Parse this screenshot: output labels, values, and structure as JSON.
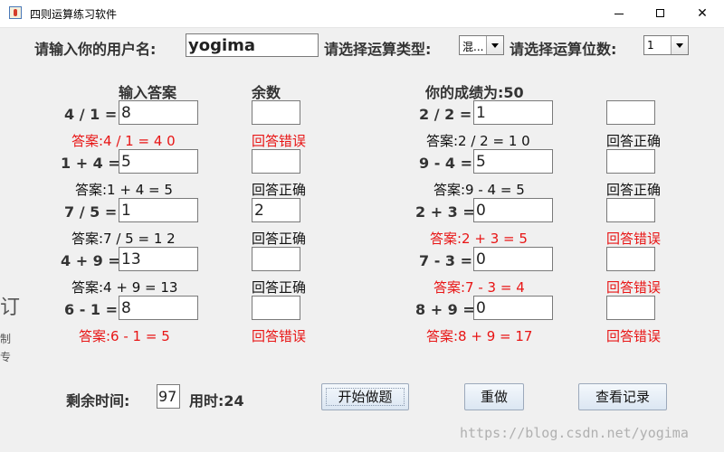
{
  "window": {
    "title": "四则运算练习软件",
    "min": "",
    "max": "",
    "close": "✕"
  },
  "header": {
    "username_label": "请输入你的用户名:",
    "username_value": "yogima",
    "op_type_label": "请选择运算类型:",
    "op_type_value": "混...",
    "digits_label": "请选择运算位数:",
    "digits_value": "1"
  },
  "columns": {
    "answer_header": "输入答案",
    "remainder_header": "余数",
    "score_text": "你的成绩为:50"
  },
  "problems_left": [
    {
      "expr": "4 / 1 =",
      "input": "8",
      "remainder": "",
      "answer": "答案:4 / 1 = 4 0",
      "result": "回答错误",
      "correct": false
    },
    {
      "expr": "1 + 4 =",
      "input": "5",
      "remainder": "",
      "answer": "答案:1 + 4 = 5",
      "result": "回答正确",
      "correct": true
    },
    {
      "expr": "7 / 5 =",
      "input": "1",
      "remainder": "2",
      "answer": "答案:7 / 5 = 1 2",
      "result": "回答正确",
      "correct": true
    },
    {
      "expr": "4 + 9 =",
      "input": "13",
      "remainder": "",
      "answer": "答案:4 + 9 = 13",
      "result": "回答正确",
      "correct": true
    },
    {
      "expr": "6 - 1 =",
      "input": "8",
      "remainder": "",
      "answer": "答案:6 - 1 = 5",
      "result": "回答错误",
      "correct": false
    }
  ],
  "problems_right": [
    {
      "expr": "2 / 2 =",
      "input": "1",
      "remainder": "",
      "answer": "答案:2 / 2 = 1 0",
      "result": "回答正确",
      "correct": true
    },
    {
      "expr": "9 - 4 =",
      "input": "5",
      "remainder": "",
      "answer": "答案:9 - 4 = 5",
      "result": "回答正确",
      "correct": true
    },
    {
      "expr": "2 + 3 =",
      "input": "0",
      "remainder": "",
      "answer": "答案:2 + 3 = 5",
      "result": "回答错误",
      "correct": false
    },
    {
      "expr": "7 - 3 =",
      "input": "0",
      "remainder": "",
      "answer": "答案:7 - 3 = 4",
      "result": "回答错误",
      "correct": false
    },
    {
      "expr": "8 + 9 =",
      "input": "0",
      "remainder": "",
      "answer": "答案:8 + 9 = 17",
      "result": "回答错误",
      "correct": false
    }
  ],
  "footer": {
    "remaining_label": "剩余时间:",
    "remaining_value": "97",
    "elapsed_text": "用时:24",
    "start_button": "开始做题",
    "redo_button": "重做",
    "records_button": "查看记录"
  },
  "watermark": "https://blog.csdn.net/yogima",
  "background_fragments": [
    "订",
    "制",
    "专"
  ],
  "colors": {
    "error": "#e81515",
    "correct": "#111111"
  }
}
